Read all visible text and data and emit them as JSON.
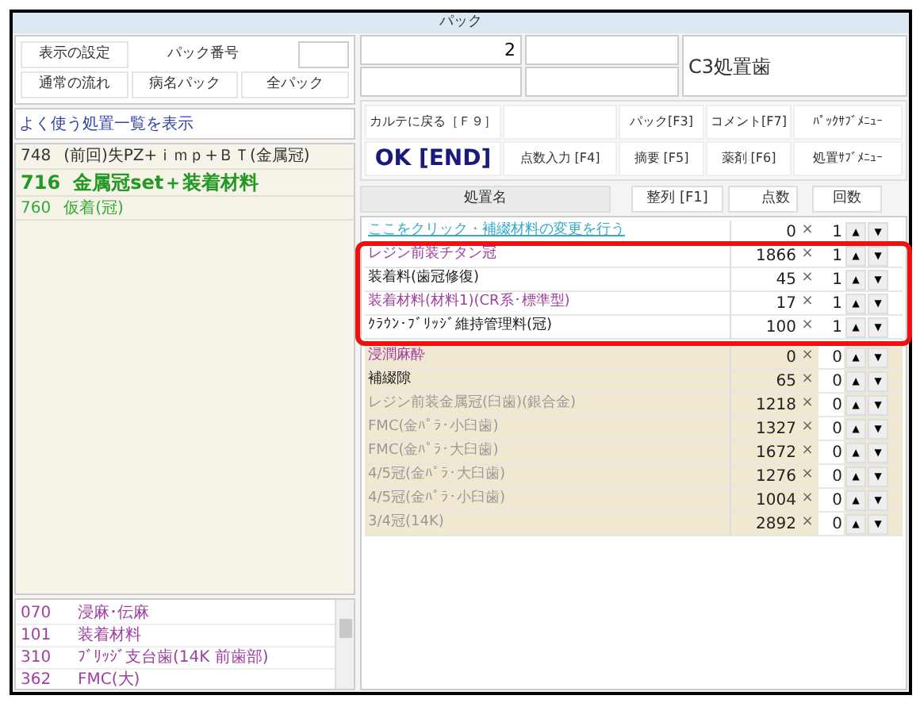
{
  "window": {
    "title": "パック"
  },
  "settings": {
    "display_settings": "表示の設定",
    "pack_number_label": "パック番号",
    "normal_flow": "通常の流れ",
    "disease_pack": "病名パック",
    "all_packs": "全パック"
  },
  "frequent_link": "よく使う処置一覧を表示",
  "frequent_list": [
    {
      "code": "748",
      "name": "(前回)失PZ+ｉｍｐ+ＢＴ(金属冠)",
      "kind": "normal"
    },
    {
      "code": "716",
      "name": "金属冠set＋装着材料",
      "kind": "emphasis"
    },
    {
      "code": "760",
      "name": "仮着(冠)",
      "kind": "green"
    }
  ],
  "category_list": [
    {
      "code": "070",
      "name": "浸麻･伝麻"
    },
    {
      "code": "101",
      "name": "装着材料"
    },
    {
      "code": "310",
      "name": "ﾌﾞﾘｯｼﾞ支台歯(14K 前歯部)"
    },
    {
      "code": "362",
      "name": "FMC(大)"
    }
  ],
  "fields": {
    "count": "2",
    "tooth": "C3処置歯"
  },
  "buttons": [
    [
      {
        "kind": "text",
        "label": "カルテに戻る［Ｆ９］"
      },
      {
        "kind": "blank"
      },
      {
        "kind": "text",
        "label": "パック[F3]"
      },
      {
        "kind": "text",
        "label": "コメント[F7]"
      },
      {
        "kind": "text",
        "label": "ﾊﾟｯｸｻﾌﾞﾒﾆｭｰ"
      }
    ],
    [
      {
        "kind": "ok",
        "label": "OK [END]"
      },
      {
        "kind": "text",
        "label": "点数入力 [F4]"
      },
      {
        "kind": "text",
        "label": "摘要 [F5]"
      },
      {
        "kind": "text",
        "label": "薬剤 [F6]"
      },
      {
        "kind": "text",
        "label": "処置ｻﾌﾞﾒﾆｭｰ"
      }
    ]
  ],
  "table": {
    "columns": [
      "処置名",
      "整列 [F1]",
      "点数",
      "回数"
    ],
    "first_row": {
      "name": "ここをクリック・補綴材料の変更を行う",
      "points": "0",
      "times": "1",
      "kind": "link"
    },
    "framed_rows": [
      {
        "name": "レジン前装チタン冠",
        "points": "1866",
        "times": "1",
        "kind": "material"
      },
      {
        "name": "装着料(歯冠修復)",
        "points": "45",
        "times": "1",
        "kind": "normal"
      },
      {
        "name": "装着材料(材料1)(CR系･標準型)",
        "points": "17",
        "times": "1",
        "kind": "material"
      },
      {
        "name": "ｸﾗｳﾝ･ﾌﾞﾘｯｼﾞ維持管理料(冠)",
        "points": "100",
        "times": "1",
        "kind": "normal"
      }
    ],
    "rest_rows": [
      {
        "name": "浸潤麻酔",
        "points": "0",
        "times": "0",
        "kind": "material"
      },
      {
        "name": "補綴隙",
        "points": "65",
        "times": "0",
        "kind": "normal"
      },
      {
        "name": "レジン前装金属冠(臼歯)(銀合金)",
        "points": "1218",
        "times": "0",
        "kind": "inactive"
      },
      {
        "name": "FMC(金ﾊﾟﾗ･小臼歯)",
        "points": "1327",
        "times": "0",
        "kind": "inactive"
      },
      {
        "name": "FMC(金ﾊﾟﾗ･大臼歯)",
        "points": "1672",
        "times": "0",
        "kind": "inactive"
      },
      {
        "name": "4/5冠(金ﾊﾟﾗ･大臼歯)",
        "points": "1276",
        "times": "0",
        "kind": "inactive"
      },
      {
        "name": "4/5冠(金ﾊﾟﾗ･小臼歯)",
        "points": "1004",
        "times": "0",
        "kind": "inactive"
      },
      {
        "name": "3/4冠(14K)",
        "points": "2892",
        "times": "0",
        "kind": "inactive"
      }
    ],
    "multiply_sign": "×",
    "up": "▲",
    "down": "▼"
  }
}
